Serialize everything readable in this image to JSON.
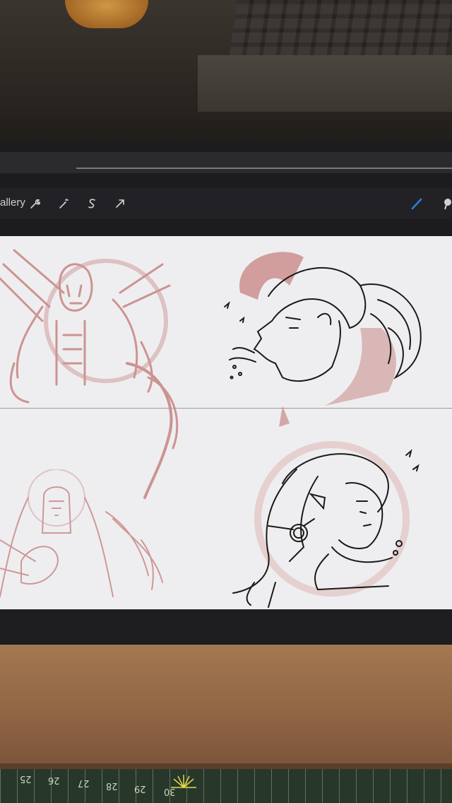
{
  "toolbar": {
    "gallery_label": "allery",
    "icons": [
      "wrench-icon",
      "magic-wand-icon",
      "selection-icon",
      "transform-arrow-icon",
      "brush-icon",
      "smudge-icon"
    ],
    "accent_color": "#2a7de1"
  },
  "canvas": {
    "background_color": "#eeeef0",
    "sketch_color": "#c98a88",
    "ink_color": "#1a1a1a",
    "sketches": [
      "grim-reaper-sketch",
      "demon-head-sketch",
      "nun-sketch",
      "elf-portrait-sketch"
    ]
  },
  "cutting_mat": {
    "numbers": [
      "25",
      "26",
      "27",
      "28",
      "29",
      "30"
    ]
  }
}
